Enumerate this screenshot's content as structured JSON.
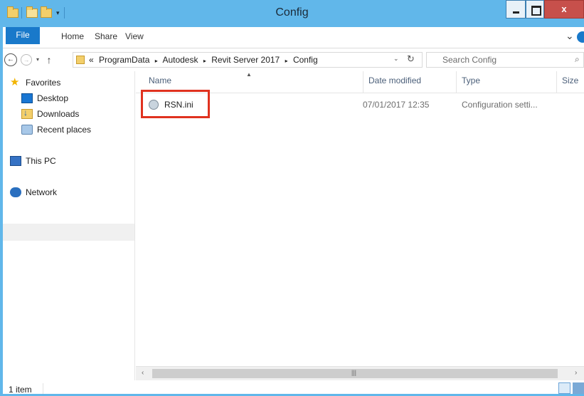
{
  "window": {
    "title": "Config",
    "close_label": "x"
  },
  "ribbon": {
    "file_tab": "File",
    "tabs": [
      "Home",
      "Share",
      "View"
    ]
  },
  "address": {
    "overflow": "«",
    "path": [
      "ProgramData",
      "Autodesk",
      "Revit Server 2017",
      "Config"
    ],
    "search_placeholder": "Search Config"
  },
  "nav": {
    "favorites": "Favorites",
    "desktop": "Desktop",
    "downloads": "Downloads",
    "recent": "Recent places",
    "this_pc": "This PC",
    "network": "Network"
  },
  "columns": {
    "name": "Name",
    "date": "Date modified",
    "type": "Type",
    "size": "Size"
  },
  "files": [
    {
      "name": "RSN.ini",
      "date": "07/01/2017 12:35",
      "type": "Configuration setti..."
    }
  ],
  "status": {
    "item_count": "1 item"
  },
  "colors": {
    "accent": "#61b7ea",
    "file_tab": "#1979ca",
    "highlight": "#e0321f"
  }
}
